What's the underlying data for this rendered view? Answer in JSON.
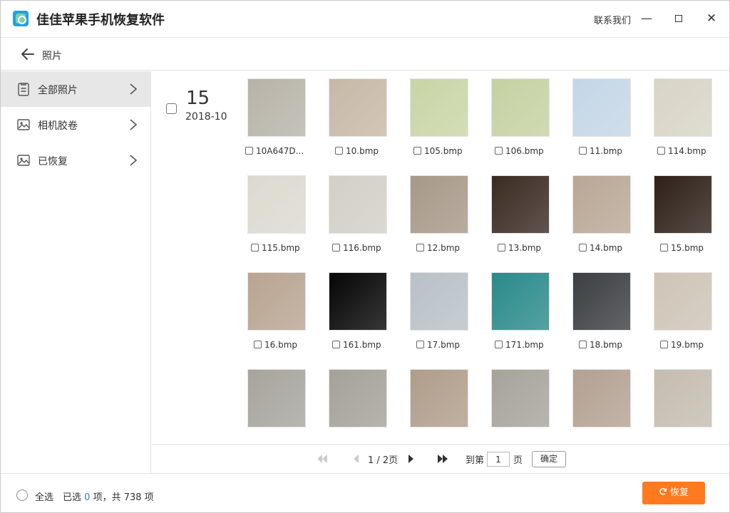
{
  "window": {
    "title": "佳佳苹果手机恢复软件",
    "contact_label": "联系我们",
    "minimize_glyph": "—",
    "close_glyph": "✕"
  },
  "nav": {
    "title": "照片",
    "back_icon": "arrow-left-icon"
  },
  "sidebar": {
    "items": [
      {
        "label": "全部照片",
        "icon": "clipboard-icon",
        "active": true
      },
      {
        "label": "相机胶卷",
        "icon": "image-icon",
        "active": false
      },
      {
        "label": "已恢复",
        "icon": "image-icon",
        "active": false
      }
    ]
  },
  "group": {
    "day": "15",
    "month": "2018-10"
  },
  "photos": [
    {
      "name": "10A647D...",
      "color": "#b7b3a8"
    },
    {
      "name": "10.bmp",
      "color": "#c7b8a6"
    },
    {
      "name": "105.bmp",
      "color": "#c8d5a5"
    },
    {
      "name": "106.bmp",
      "color": "#c5d1a1"
    },
    {
      "name": "11.bmp",
      "color": "#c4d6e6"
    },
    {
      "name": "114.bmp",
      "color": "#d8d4c6"
    },
    {
      "name": "115.bmp",
      "color": "#dcd9d0"
    },
    {
      "name": "116.bmp",
      "color": "#d2cfc6"
    },
    {
      "name": "12.bmp",
      "color": "#a79888"
    },
    {
      "name": "13.bmp",
      "color": "#3a2a22"
    },
    {
      "name": "14.bmp",
      "color": "#b9a795"
    },
    {
      "name": "15.bmp",
      "color": "#2e2018"
    },
    {
      "name": "16.bmp",
      "color": "#b8a491"
    },
    {
      "name": "161.bmp",
      "color": "#050505"
    },
    {
      "name": "17.bmp",
      "color": "#b8c1c7"
    },
    {
      "name": "171.bmp",
      "color": "#2a8a8a"
    },
    {
      "name": "18.bmp",
      "color": "#3b3e42"
    },
    {
      "name": "19.bmp",
      "color": "#cec4b6"
    },
    {
      "name": "",
      "color": "#a6a49d"
    },
    {
      "name": "",
      "color": "#a4a199"
    },
    {
      "name": "",
      "color": "#b09d8a"
    },
    {
      "name": "",
      "color": "#a6a39b"
    },
    {
      "name": "",
      "color": "#b3a192"
    },
    {
      "name": "",
      "color": "#c4bcb0"
    }
  ],
  "pagination": {
    "page_label": "1 / 2页",
    "goto_label": "到第",
    "page_value": "1",
    "page_suffix": "页",
    "confirm_label": "确定"
  },
  "footer": {
    "select_all_label": "全选",
    "selected_prefix": "已选",
    "selected_count": "0",
    "selected_suffix": "项，共 738 项",
    "recover_label": "恢复",
    "recover_color": "#ff7a1f"
  }
}
